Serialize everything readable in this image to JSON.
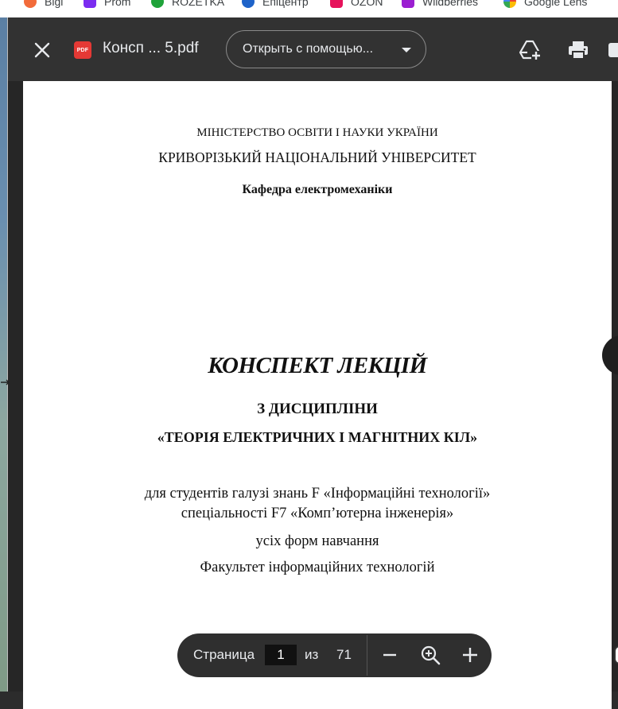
{
  "bookmarks": [
    {
      "label": "Bigl",
      "color": "#f26b3a"
    },
    {
      "label": "Prom",
      "color": "#7b2cf0"
    },
    {
      "label": "ROZETKA",
      "color": "#1fa33a"
    },
    {
      "label": "Епіцентр",
      "color": "#1e63c9"
    },
    {
      "label": "OZON",
      "color": "#e6125b"
    },
    {
      "label": "Wildberries",
      "color": "#9b1fd1"
    },
    {
      "label": "Google Lens",
      "color": "#ea4335"
    }
  ],
  "toolbar": {
    "close_icon": "close-icon",
    "file_badge": "PDF",
    "file_title": "Консп ... 5.pdf",
    "open_with_label": "Открыть с помощью...",
    "icons": [
      "add-to-drive-icon",
      "print-icon"
    ]
  },
  "document": {
    "ministry": "МІНІСТЕРСТВО ОСВІТИ І НАУКИ УКРАЇНИ",
    "university": "КРИВОРІЗЬКИЙ НАЦІОНАЛЬНИЙ УНІВЕРСИТЕТ",
    "department": "Кафедра електромеханіки",
    "title": "КОНСПЕКТ ЛЕКЦІЙ",
    "discipline_prefix": "З ДИСЦИПЛІНИ",
    "discipline": "«ТЕОРІЯ ЕЛЕКТРИЧНИХ І МАГНІТНИХ КІЛ»",
    "audience_field": "для студентів галузі знань  F «Інформаційні технології»",
    "audience_specialty": "спеціальності F7 «Комп’ютерна інженерія»",
    "study_forms": "усіх форм навчання",
    "faculty": "Факультет інформаційних технологій"
  },
  "pager": {
    "page_label": "Страница",
    "current_page": "1",
    "of_label": "из",
    "total_pages": "71",
    "icons": [
      "zoom-out-icon",
      "zoom-fit-icon",
      "zoom-in-icon"
    ]
  }
}
